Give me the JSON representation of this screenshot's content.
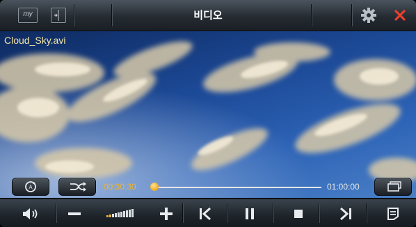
{
  "app": {
    "title": "비디오"
  },
  "header": {
    "my_label": "my",
    "icons": [
      "my-icon",
      "sidebar-panel-icon",
      "gear-icon",
      "close-icon"
    ]
  },
  "video": {
    "filename": "Cloud_Sky.avi"
  },
  "playback": {
    "current_time": "00:30:30",
    "total_time": "01:00:00",
    "progress_fraction": 0.0
  },
  "volume": {
    "level_fraction": 0.2,
    "segments": 10
  },
  "colors": {
    "accent": "#E8B33B",
    "close": "#E8402C",
    "filename": "#F4E6A6"
  },
  "controls": {
    "overlay": [
      "repeat-icon",
      "shuffle-icon",
      "fullscreen-icon"
    ],
    "bottom": [
      "speaker-icon",
      "volume-down-icon",
      "volume-bar",
      "volume-up-icon",
      "previous-icon",
      "pause-icon",
      "stop-icon",
      "next-icon",
      "playlist-icon"
    ]
  }
}
